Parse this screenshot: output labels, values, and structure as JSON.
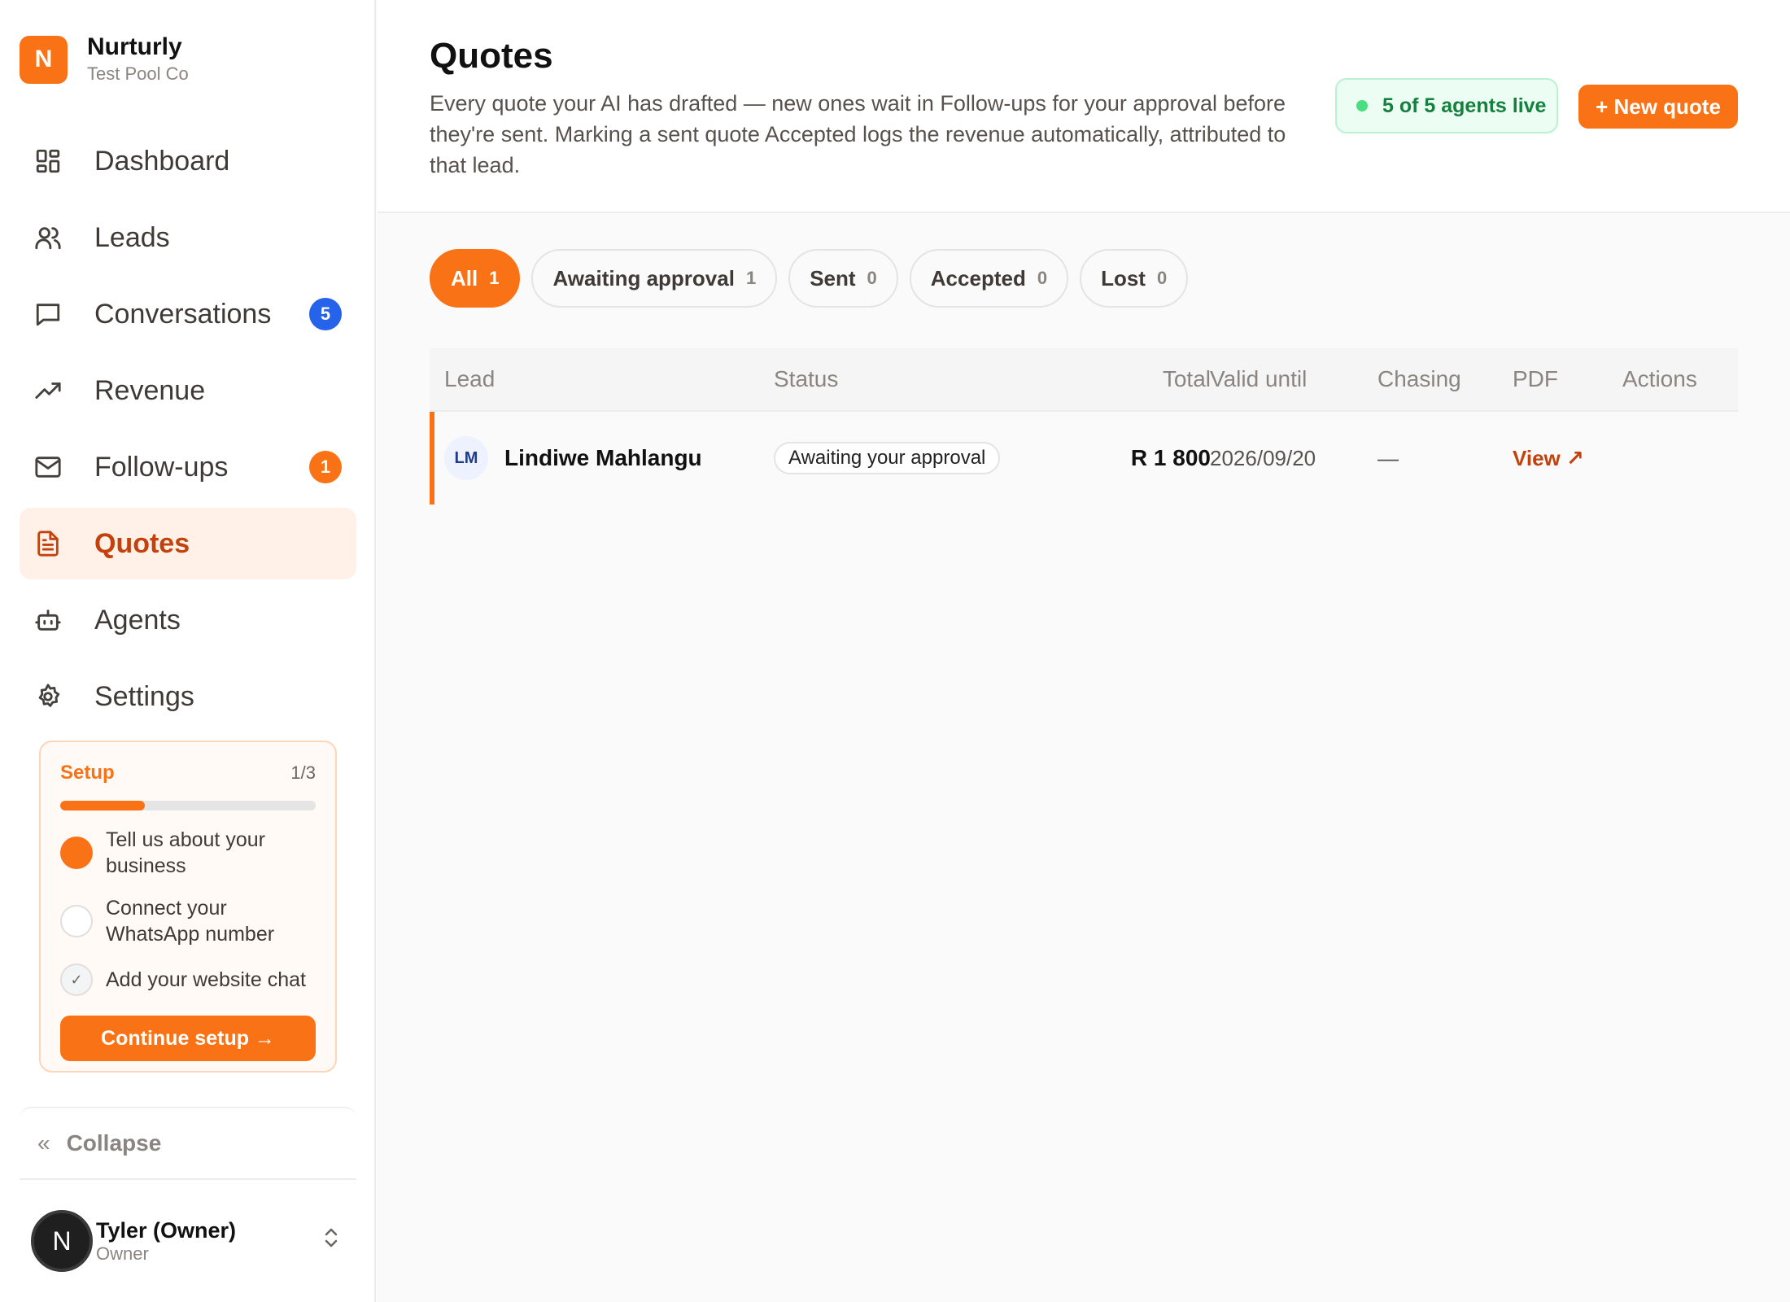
{
  "brand": {
    "initial": "N",
    "name": "Nurturly",
    "org": "Test Pool Co"
  },
  "nav": [
    {
      "label": "Dashboard",
      "icon": "dashboard-icon"
    },
    {
      "label": "Leads",
      "icon": "users-icon"
    },
    {
      "label": "Conversations",
      "icon": "chat-icon",
      "badge": "5",
      "badge_color": "#2563eb"
    },
    {
      "label": "Revenue",
      "icon": "trending-up-icon"
    },
    {
      "label": "Follow-ups",
      "icon": "mail-icon",
      "badge": "1",
      "badge_color": "#f97316"
    },
    {
      "label": "Quotes",
      "icon": "document-icon",
      "active": true
    },
    {
      "label": "Agents",
      "icon": "bot-icon"
    },
    {
      "label": "Settings",
      "icon": "gear-icon"
    }
  ],
  "setup": {
    "title": "Setup",
    "count": "1/3",
    "progress": 0.33,
    "steps": [
      {
        "text": "Tell us about your business",
        "state": "done"
      },
      {
        "text": "Connect your WhatsApp number",
        "state": "todo"
      },
      {
        "text": "Add your website chat",
        "state": "check"
      }
    ],
    "button": "Continue setup →"
  },
  "collapse": {
    "icon": "«",
    "label": "Collapse"
  },
  "user": {
    "initial": "N",
    "name": "Tyler (Owner)",
    "role": "Owner",
    "switch": "⌃⌄"
  },
  "header": {
    "title": "Quotes",
    "description": "Every quote your AI has drafted — new ones wait in Follow-ups for your approval before they're sent. Marking a sent quote Accepted logs the revenue automatically, attributed to that lead.",
    "live_status": "5 of 5 agents live",
    "new_button": "+ New quote"
  },
  "filters": [
    {
      "label": "All",
      "count": "1",
      "active": true
    },
    {
      "label": "Awaiting approval",
      "count": "1"
    },
    {
      "label": "Sent",
      "count": "0"
    },
    {
      "label": "Accepted",
      "count": "0"
    },
    {
      "label": "Lost",
      "count": "0"
    }
  ],
  "table": {
    "columns": {
      "lead": "Lead",
      "status": "Status",
      "total": "Total",
      "valid": "Valid until",
      "chasing": "Chasing",
      "pdf": "PDF",
      "actions": "Actions"
    },
    "rows": [
      {
        "initials": "LM",
        "lead": "Lindiwe Mahlangu",
        "status": "Awaiting your approval",
        "total": "R 1 800",
        "valid": "2026/09/20",
        "chasing": "—",
        "pdf": "View ↗"
      }
    ]
  },
  "colors": {
    "accent": "#f97316",
    "accent_dark": "#c2410c",
    "live_green": "#15803d"
  }
}
